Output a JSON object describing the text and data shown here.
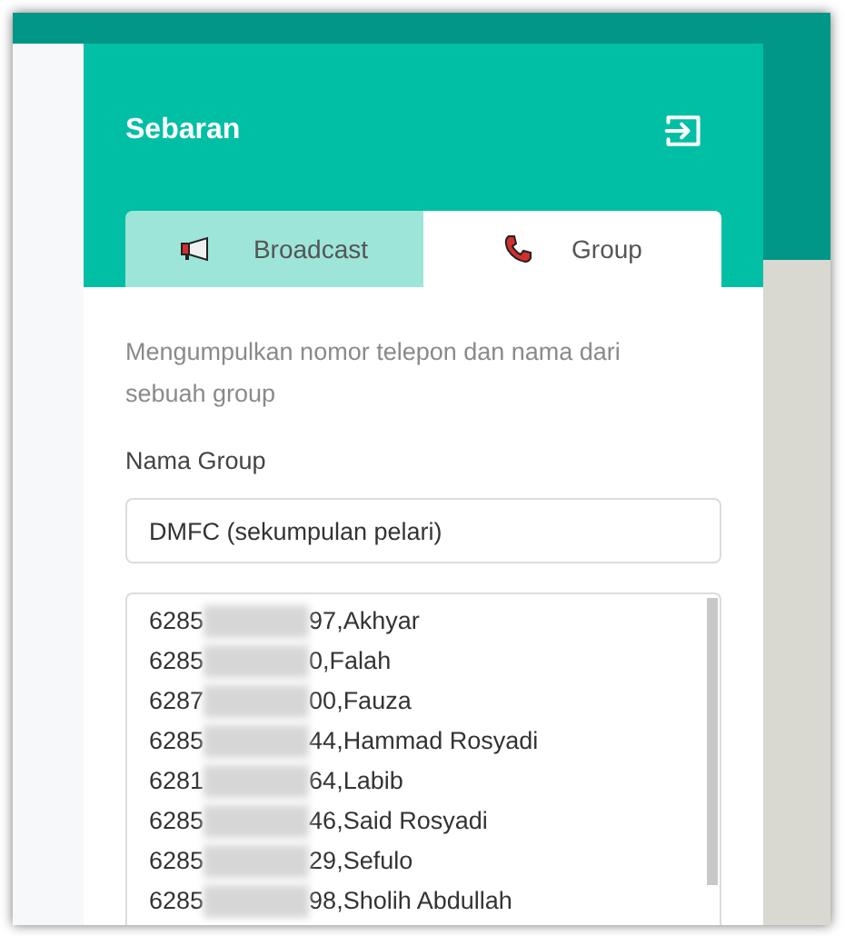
{
  "header": {
    "title": "Sebaran"
  },
  "tabs": [
    {
      "label": "Broadcast",
      "kind": "megaphone",
      "selected": false
    },
    {
      "label": "Group",
      "kind": "phone",
      "selected": true
    }
  ],
  "description": "Mengumpulkan nomor telepon dan nama dari sebuah group",
  "group_name": {
    "label": "Nama Group",
    "value": "DMFC (sekumpulan pelari)"
  },
  "contacts": [
    {
      "prefix": "6285",
      "suffix": "97,Akhyar"
    },
    {
      "prefix": "6285",
      "suffix": "0,Falah"
    },
    {
      "prefix": "6287",
      "suffix": "00,Fauza"
    },
    {
      "prefix": "6285",
      "suffix": "44,Hammad Rosyadi"
    },
    {
      "prefix": "6281",
      "suffix": "64,Labib"
    },
    {
      "prefix": "6285",
      "suffix": "46,Said Rosyadi"
    },
    {
      "prefix": "6285",
      "suffix": "29,Sefulo"
    },
    {
      "prefix": "6285",
      "suffix": "98,Sholih Abdullah"
    }
  ]
}
